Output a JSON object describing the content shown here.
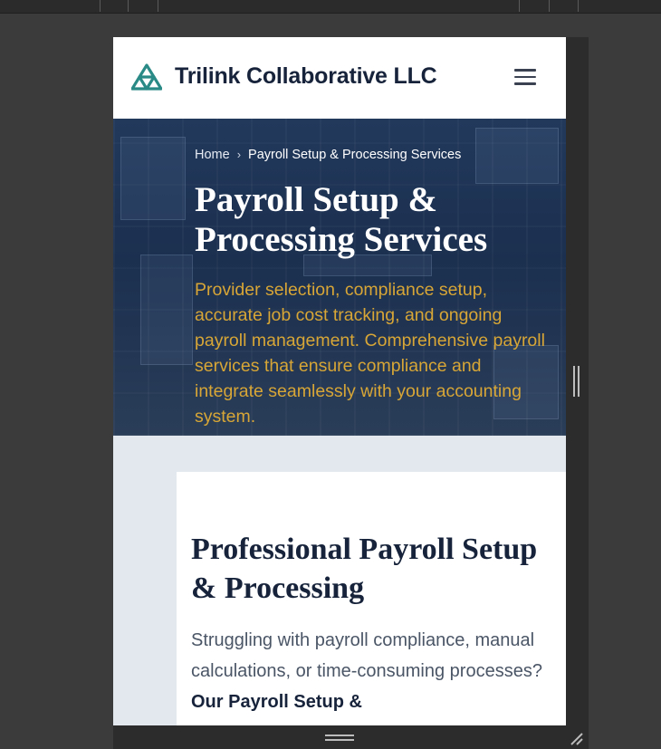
{
  "site": {
    "brand": "Trilink Collaborative LLC"
  },
  "breadcrumb": {
    "home": "Home",
    "separator": "›",
    "current": "Payroll Setup & Processing Services"
  },
  "hero": {
    "title": "Payroll Setup & Processing Services",
    "subtitle": "Provider selection, compliance setup, accurate job cost tracking, and ongoing payroll management. Comprehensive payroll services that ensure compliance and integrate seamlessly with your accounting system."
  },
  "section": {
    "title": "Professional Payroll Setup & Processing",
    "intro_text": "Struggling with payroll compliance, manual calculations, or time-consuming processes?",
    "intro_bold": "Our Payroll Setup &"
  },
  "icons": {
    "logo": "triple-ring-logo-icon",
    "menu": "hamburger-menu-icon",
    "resize_vertical": "drag-handle-icon",
    "resize_corner": "resize-grip-icon"
  },
  "colors": {
    "navy": "#16233a",
    "gold": "#d7a636",
    "teal": "#2a8a86",
    "hero_bg": "#1f3556",
    "section_bg": "#e3e8ef"
  }
}
